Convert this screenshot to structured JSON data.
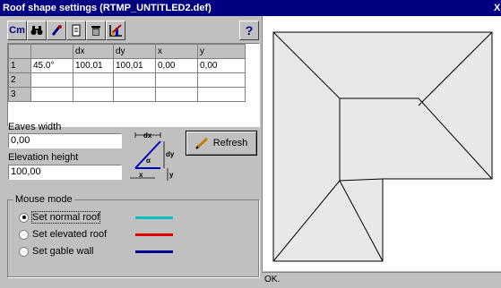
{
  "window": {
    "title": "Roof shape settings (RTMP_UNTITLED2.def)"
  },
  "toolbar": {
    "cm_label": "Cm",
    "help_label": "?",
    "icons": [
      "cm-icon",
      "binoculars-icon",
      "paint-icon",
      "document-icon",
      "delete-icon",
      "chart-icon",
      "help-icon"
    ]
  },
  "table": {
    "headers": [
      "",
      "",
      "dx",
      "dy",
      "x",
      "y"
    ],
    "rows": [
      [
        "1",
        "45.0°",
        "100,01",
        "100,01",
        "0,00",
        "0,00"
      ],
      [
        "2",
        "",
        "",
        "",
        "",
        ""
      ],
      [
        "3",
        "",
        "",
        "",
        "",
        ""
      ]
    ]
  },
  "eaves": {
    "label": "Eaves width",
    "value": "0,00"
  },
  "elevation": {
    "label": "Elevation height",
    "value": "100,00"
  },
  "diagram": {
    "dx": "dx",
    "dy": "dy",
    "alpha": "α",
    "x": "x",
    "y": "y"
  },
  "refresh": {
    "label": "Refresh"
  },
  "mouse_mode": {
    "title": "Mouse mode",
    "options": [
      {
        "label": "Set normal roof",
        "color": "#00c0c0",
        "selected": true
      },
      {
        "label": "Set elevated roof",
        "color": "#e00000",
        "selected": false
      },
      {
        "label": "Set gable wall",
        "color": "#000090",
        "selected": false
      }
    ]
  },
  "status": {
    "text": "OK."
  }
}
